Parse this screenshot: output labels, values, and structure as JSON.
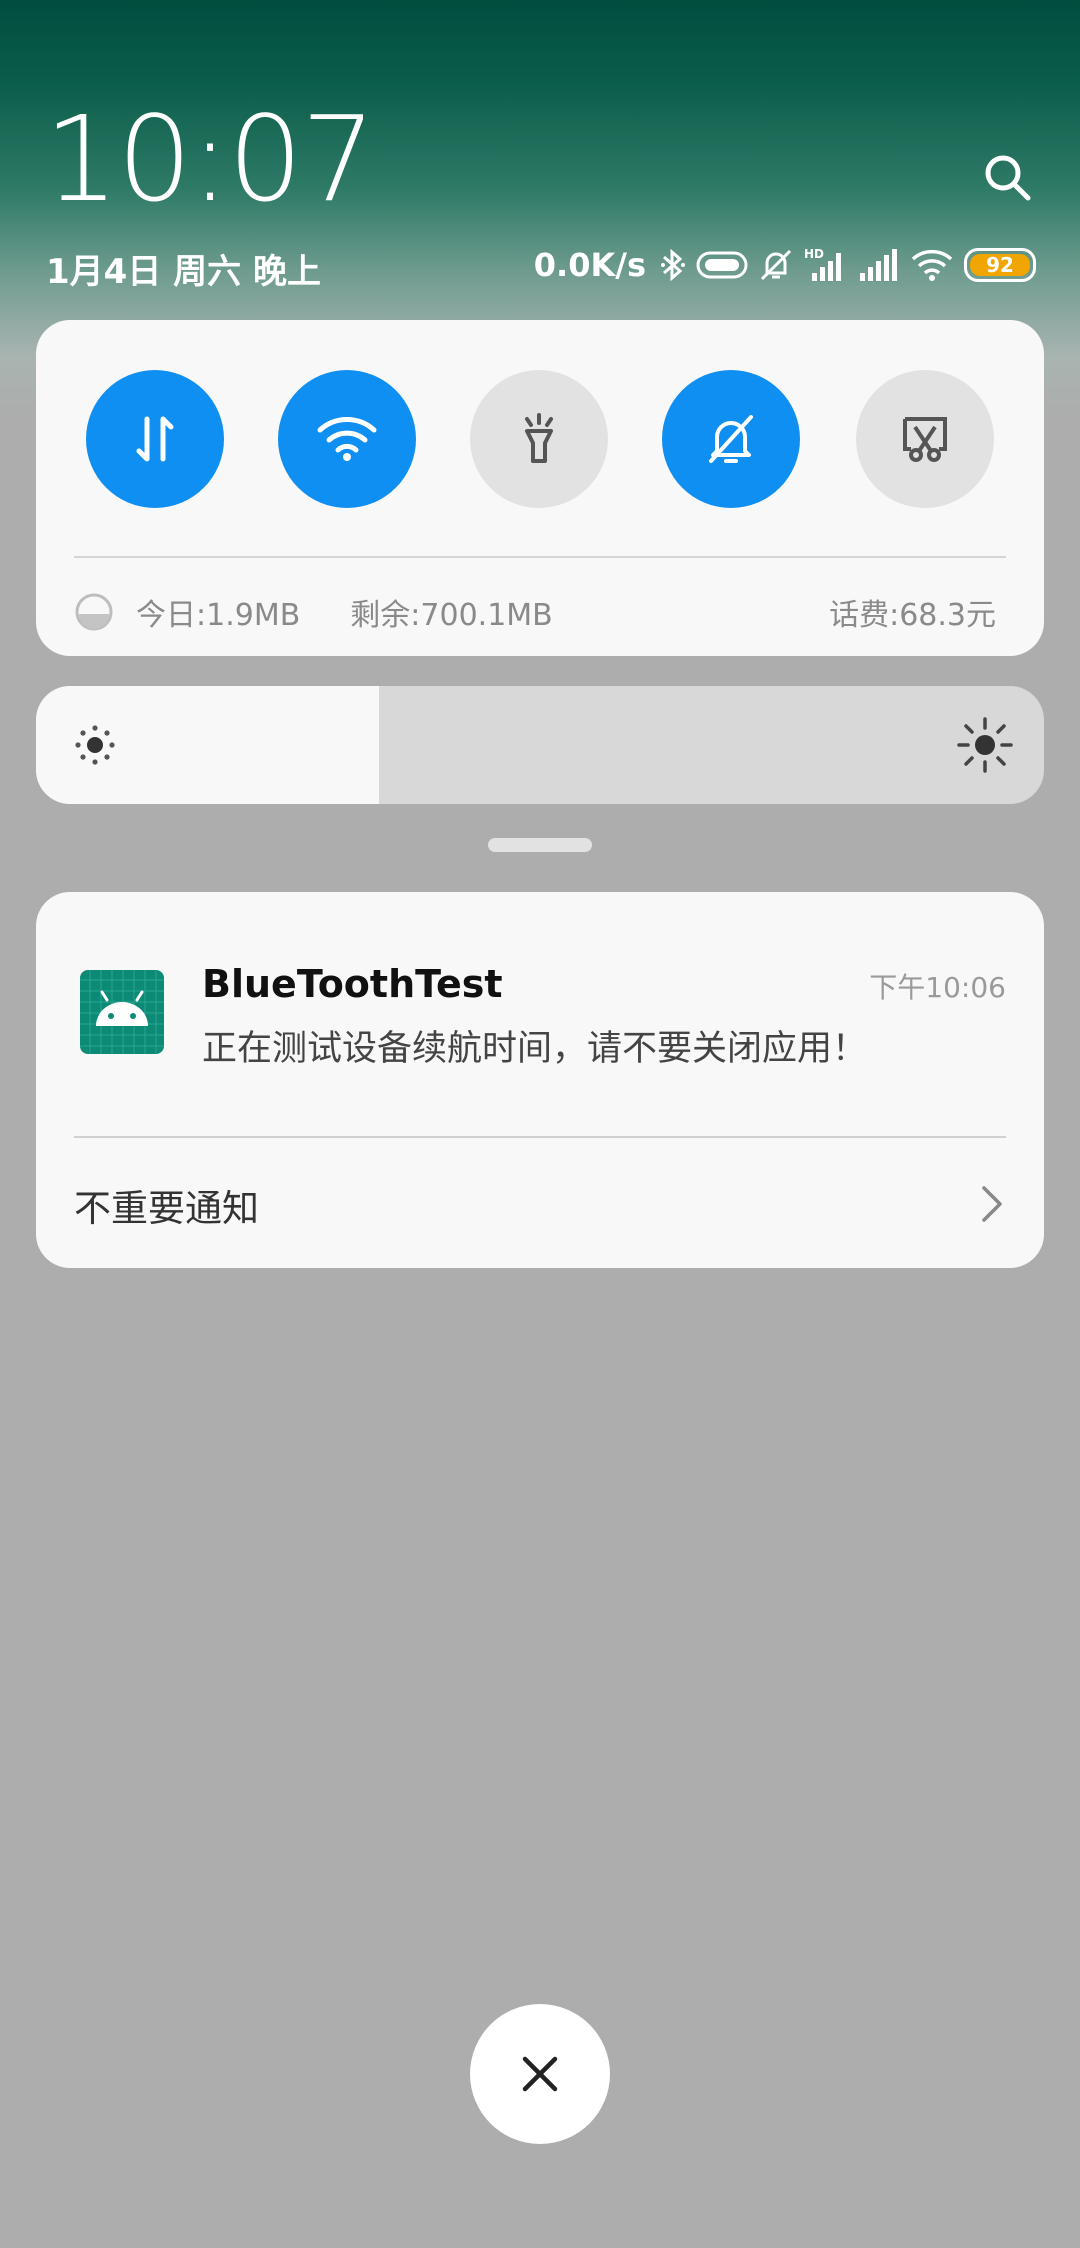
{
  "status_bar": {
    "time": "10:07",
    "date": "1月4日 周六 晚上",
    "net_speed": "0.0K/s",
    "signal_hd_label": "HD",
    "battery": "92",
    "icons": [
      "bluetooth-icon",
      "vibrate-toggle-icon",
      "mute-bell-icon",
      "signal-hd-icon",
      "signal-icon",
      "wifi-icon",
      "battery-icon"
    ]
  },
  "search_icon": "search-icon",
  "quick_settings": {
    "tiles": [
      {
        "name": "mobile-data",
        "icon": "data-arrows-icon",
        "active": true
      },
      {
        "name": "wifi",
        "icon": "wifi-icon",
        "active": true
      },
      {
        "name": "flashlight",
        "icon": "flashlight-icon",
        "active": false
      },
      {
        "name": "silent",
        "icon": "bell-off-icon",
        "active": true
      },
      {
        "name": "screenshot",
        "icon": "scissors-screenshot-icon",
        "active": false
      }
    ],
    "data_today": "今日:1.9MB",
    "data_remaining": "剩余:700.1MB",
    "phone_fee": "话费:68.3元"
  },
  "brightness": {
    "level_percent": 34,
    "icon_low": "sun-small-icon",
    "icon_high": "sun-large-icon"
  },
  "notification": {
    "app_name": "BlueToothTest",
    "time": "下午10:06",
    "text": "正在测试设备续航时间，请不要关闭应用！",
    "footer": "不重要通知"
  },
  "colors": {
    "accent": "#0f8ff2",
    "tile_off": "#e2e2e2",
    "card_bg": "#f8f8f8",
    "backdrop": "#adadad",
    "battery": "#f0a500",
    "app_icon": "#0c8a76"
  }
}
